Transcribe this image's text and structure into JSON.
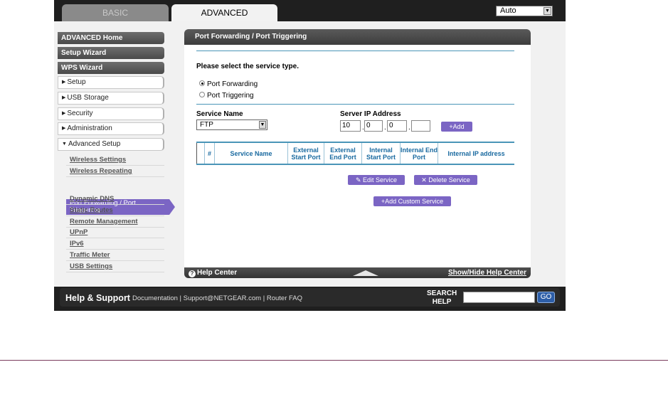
{
  "tabs": {
    "basic": "BASIC",
    "advanced": "ADVANCED"
  },
  "language": {
    "selected": "Auto"
  },
  "sidebar": {
    "main_items": [
      "ADVANCED Home",
      "Setup Wizard",
      "WPS Wizard"
    ],
    "sections": [
      "Setup",
      "USB Storage",
      "Security",
      "Administration"
    ],
    "advanced_setup": "Advanced Setup",
    "sub_items": [
      "Wireless Settings",
      "Wireless Repeating",
      "Port Forwarding / Port Triggering",
      "Dynamic DNS",
      "Static Routes",
      "Remote Management",
      "UPnP",
      "IPv6",
      "Traffic Meter",
      "USB Settings"
    ],
    "active_sub_line1": "Port Forwarding / Port",
    "active_sub_line2": "Triggering"
  },
  "panel": {
    "title": "Port Forwarding / Port Triggering",
    "prompt": "Please select the service type.",
    "radio_forwarding": "Port Forwarding",
    "radio_triggering": "Port Triggering",
    "service_name_label": "Service Name",
    "service_name_value": "FTP",
    "server_ip_label": "Server IP Address",
    "ip": [
      "10",
      "0",
      "0",
      ""
    ],
    "add_label": "Add",
    "table_headers": [
      "#",
      "Service Name",
      "External Start Port",
      "External End Port",
      "Internal Start Port",
      "Internal End Port",
      "Internal IP address"
    ],
    "edit_label": "Edit Service",
    "delete_label": "Delete Service",
    "add_custom_label": "Add Custom Service",
    "help_center": "Help Center",
    "show_hide": "Show/Hide Help Center"
  },
  "footer": {
    "title": "Help & Support",
    "documentation": "Documentation",
    "support": "Support@NETGEAR.com",
    "faq": "Router FAQ",
    "search_line1": "SEARCH",
    "search_line2": "HELP",
    "go": "GO"
  },
  "colors": {
    "accent": "#7b65c4",
    "rule": "#4a95b8",
    "header_text": "#1a6aa0"
  },
  "icons": {
    "radio_selected": "radio-selected",
    "edit": "pencil-icon",
    "delete": "x-icon",
    "add": "plus-icon",
    "help": "question-icon",
    "expand": "up-triangle-icon"
  }
}
